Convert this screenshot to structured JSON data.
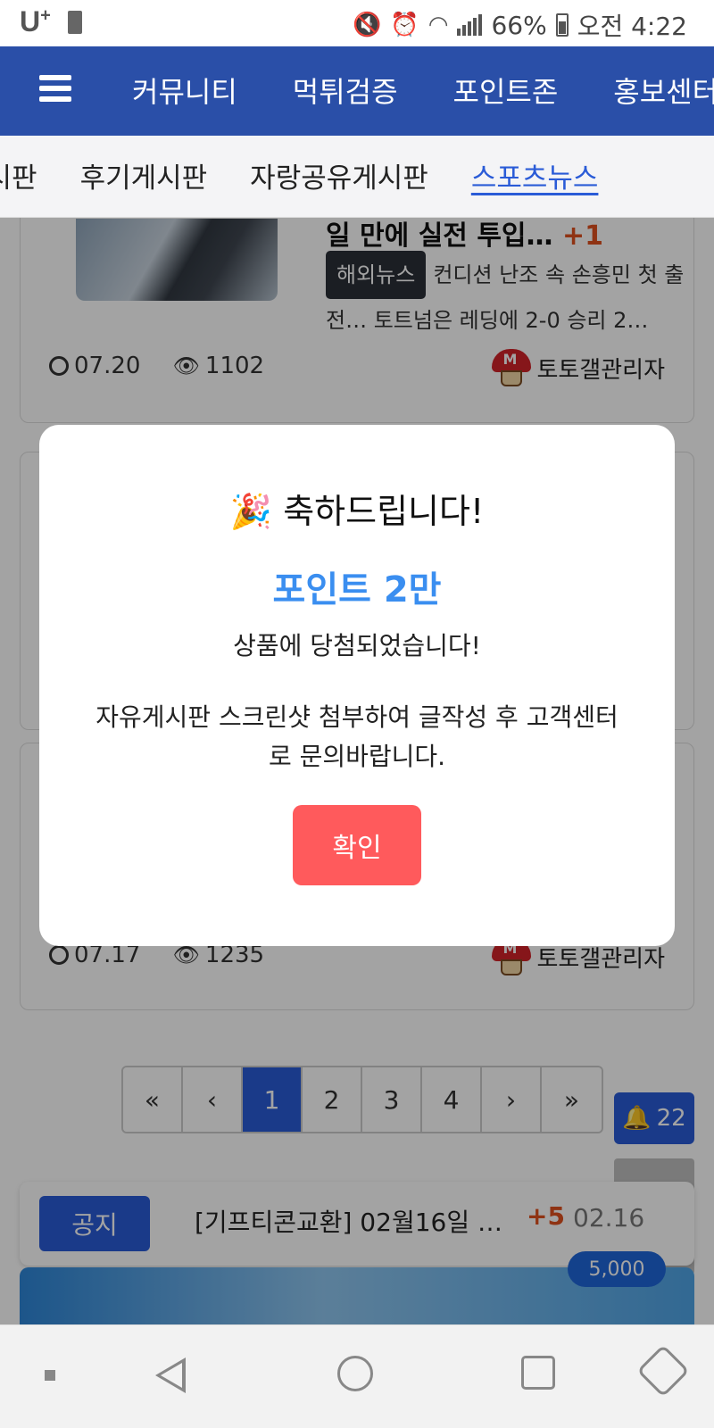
{
  "status_bar": {
    "carrier": "U",
    "carrier_plus": "+",
    "battery_percent": "66%",
    "time": "오전 4:22",
    "icons": [
      "usb-icon",
      "mute-icon",
      "alarm-icon",
      "wifi-icon",
      "signal-icon",
      "battery-icon"
    ]
  },
  "top_nav": {
    "menu_icon": "hamburger-icon",
    "items": [
      {
        "label": "커뮤니티"
      },
      {
        "label": "먹튀검증"
      },
      {
        "label": "포인트존"
      },
      {
        "label": "홍보센터"
      }
    ]
  },
  "sub_nav": {
    "items": [
      {
        "label": "게시판"
      },
      {
        "label": "후기게시판"
      },
      {
        "label": "자랑공유게시판"
      },
      {
        "label": "스포츠뉴스"
      }
    ],
    "active_index": 3
  },
  "posts": [
    {
      "title": "일 만에 실전 투입…",
      "plus": "+1",
      "tag": "해외뉴스",
      "snippet": "컨디션 난조 속 손흥민 첫 출전… 토트넘은 레딩에 2-0 승리 2…",
      "date": "07.20",
      "views": "1102",
      "author": "토토갤관리자"
    },
    {
      "date": "07.17",
      "views": "1235",
      "author": "토토갤관리자"
    }
  ],
  "pagination": {
    "first": "«",
    "prev": "‹",
    "pages": [
      "1",
      "2",
      "3",
      "4"
    ],
    "current": "1",
    "next": "›",
    "last": "»"
  },
  "notifications": {
    "count": "22"
  },
  "notice": {
    "badge": "공지",
    "title": "[기프티콘교환] 02월16일 …",
    "plus": "+5",
    "date": "02.16"
  },
  "points_badge": "5,000",
  "modal": {
    "emoji": "🎉",
    "title": "축하드립니다!",
    "prize": "포인트 2만",
    "line1": "상품에 당첨되었습니다!",
    "line2": "자유게시판 스크린샷 첨부하여 글작성 후 고객센터로 문의바랍니다.",
    "confirm_label": "확인"
  },
  "colors": {
    "nav_blue": "#2a4fa8",
    "accent_blue": "#2a5bd7",
    "prize_blue": "#3a8ef0",
    "confirm_red": "#ff5a5c",
    "plus_orange": "#e0501e"
  }
}
